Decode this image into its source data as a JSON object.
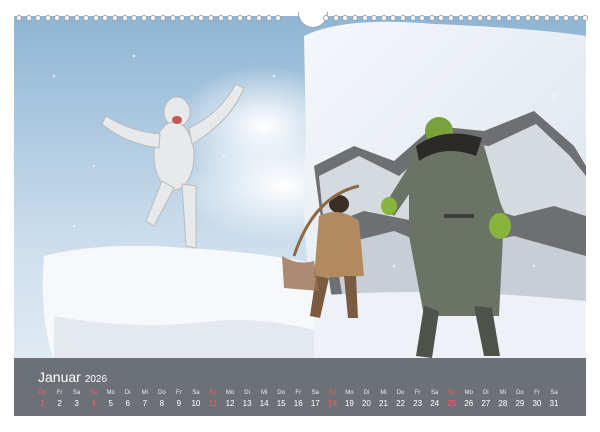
{
  "calendar": {
    "month": "Januar",
    "year": "2026",
    "days": [
      {
        "name": "Do",
        "num": "1",
        "type": "holiday"
      },
      {
        "name": "Fr",
        "num": "2",
        "type": "weekday"
      },
      {
        "name": "Sa",
        "num": "3",
        "type": "sat"
      },
      {
        "name": "So",
        "num": "4",
        "type": "sun"
      },
      {
        "name": "Mo",
        "num": "5",
        "type": "weekday"
      },
      {
        "name": "Di",
        "num": "6",
        "type": "weekday"
      },
      {
        "name": "Mi",
        "num": "7",
        "type": "weekday"
      },
      {
        "name": "Do",
        "num": "8",
        "type": "weekday"
      },
      {
        "name": "Fr",
        "num": "9",
        "type": "weekday"
      },
      {
        "name": "Sa",
        "num": "10",
        "type": "sat"
      },
      {
        "name": "So",
        "num": "11",
        "type": "sun"
      },
      {
        "name": "Mo",
        "num": "12",
        "type": "weekday"
      },
      {
        "name": "Di",
        "num": "13",
        "type": "weekday"
      },
      {
        "name": "Mi",
        "num": "14",
        "type": "weekday"
      },
      {
        "name": "Do",
        "num": "15",
        "type": "weekday"
      },
      {
        "name": "Fr",
        "num": "16",
        "type": "weekday"
      },
      {
        "name": "Sa",
        "num": "17",
        "type": "sat"
      },
      {
        "name": "So",
        "num": "18",
        "type": "sun"
      },
      {
        "name": "Mo",
        "num": "19",
        "type": "weekday"
      },
      {
        "name": "Di",
        "num": "20",
        "type": "weekday"
      },
      {
        "name": "Mi",
        "num": "21",
        "type": "weekday"
      },
      {
        "name": "Do",
        "num": "22",
        "type": "weekday"
      },
      {
        "name": "Fr",
        "num": "23",
        "type": "weekday"
      },
      {
        "name": "Sa",
        "num": "24",
        "type": "sat"
      },
      {
        "name": "So",
        "num": "25",
        "type": "sun"
      },
      {
        "name": "Mo",
        "num": "26",
        "type": "weekday"
      },
      {
        "name": "Di",
        "num": "27",
        "type": "weekday"
      },
      {
        "name": "Mi",
        "num": "28",
        "type": "weekday"
      },
      {
        "name": "Do",
        "num": "29",
        "type": "weekday"
      },
      {
        "name": "Fr",
        "num": "30",
        "type": "weekday"
      },
      {
        "name": "Sa",
        "num": "31",
        "type": "sat"
      }
    ]
  },
  "colors": {
    "strip": "#585c62",
    "sunday": "#ff5a5a",
    "sky": "#bcd6ea",
    "snow": "#f4f7fa"
  },
  "icons": [
    "spiral-binding-icon",
    "hanger-icon"
  ]
}
